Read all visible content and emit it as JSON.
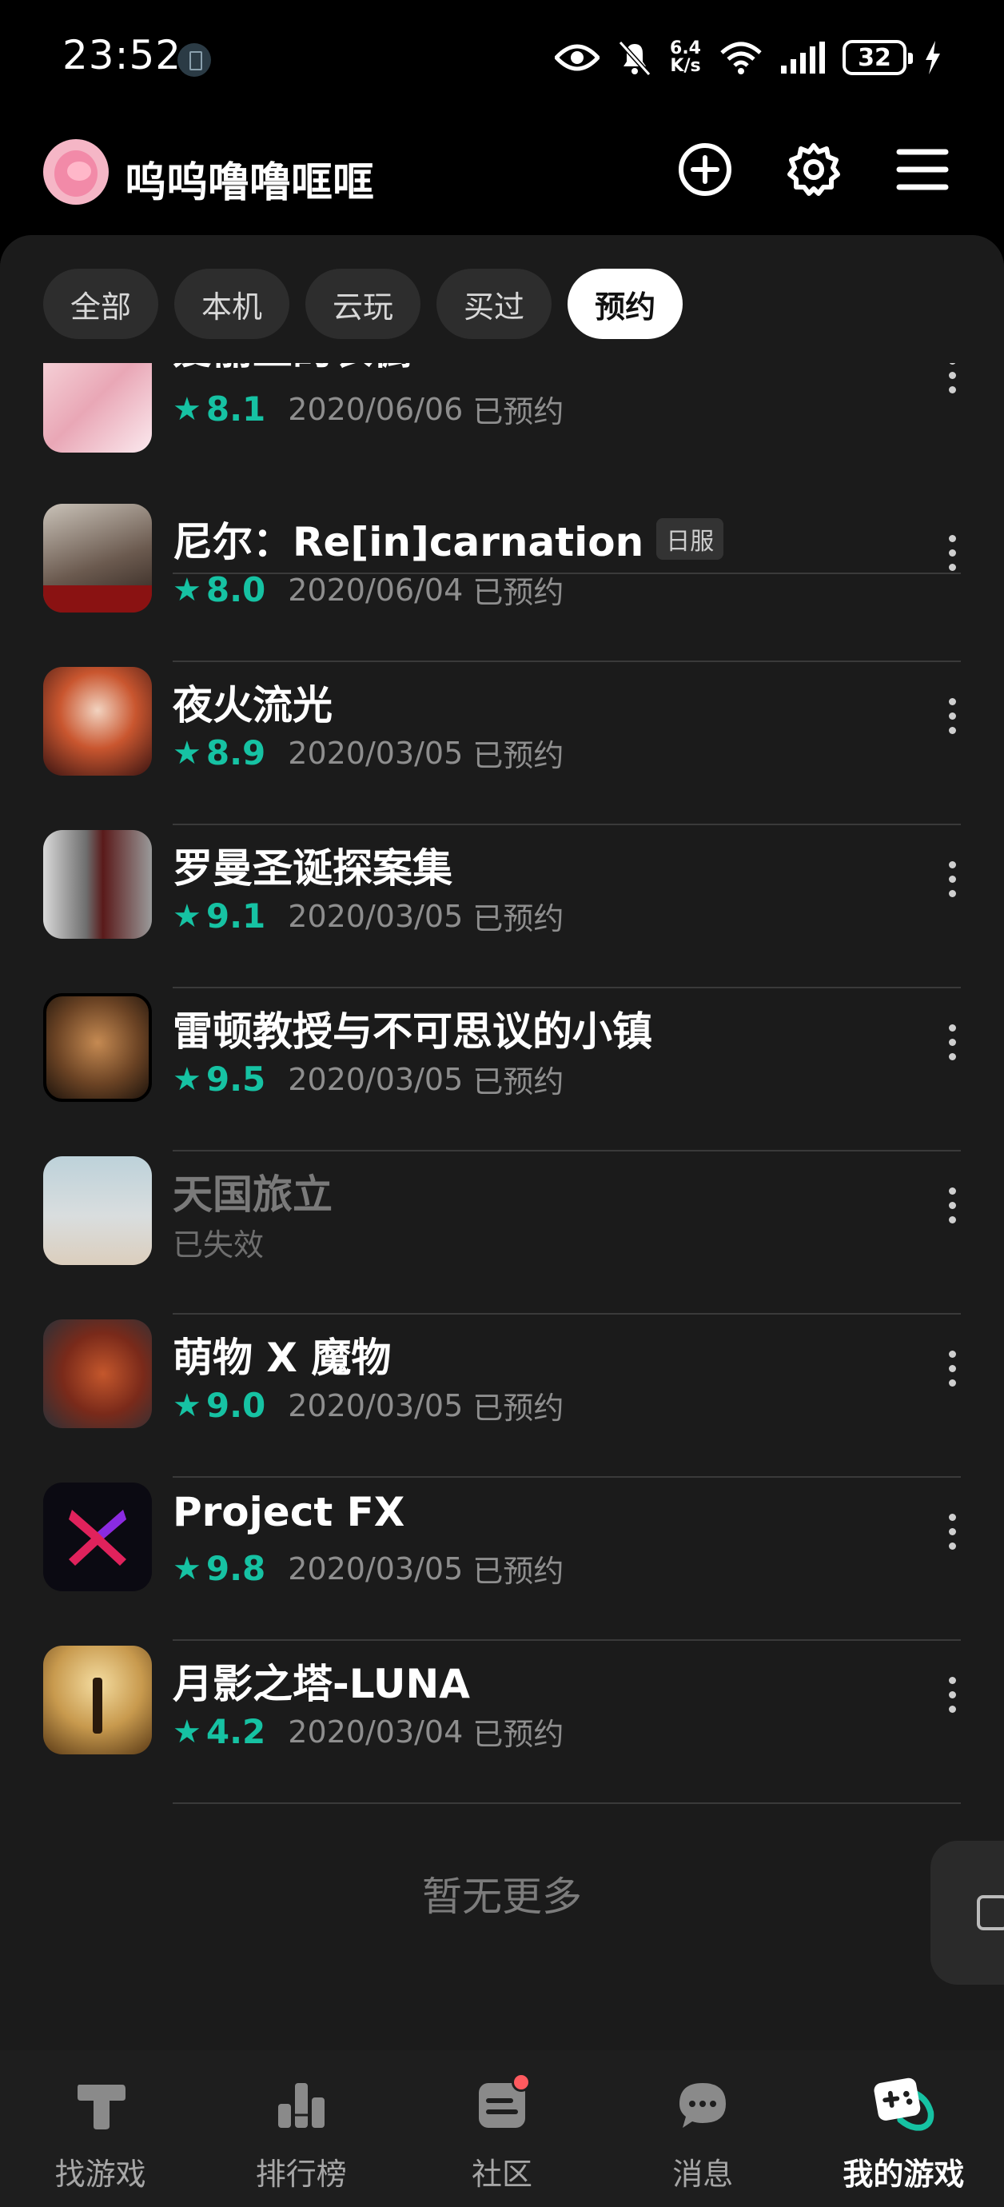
{
  "status_bar": {
    "time": "23:52",
    "net_speed_value": "6.4",
    "net_speed_unit": "K/s",
    "wifi_label": "6",
    "battery": "32"
  },
  "header": {
    "username": "呜呜噜噜哐哐"
  },
  "tabs": [
    {
      "label": "全部",
      "active": false
    },
    {
      "label": "本机",
      "active": false
    },
    {
      "label": "云玩",
      "active": false
    },
    {
      "label": "买过",
      "active": false
    },
    {
      "label": "预约",
      "active": true
    }
  ],
  "games": [
    {
      "name": "爱丽丝的衣橱",
      "tag": "",
      "rating": "8.1",
      "date": "2020/06/06",
      "status": "已预约",
      "invalid": false
    },
    {
      "name": "尼尔：Re[in]carnation",
      "tag": "日服",
      "rating": "8.0",
      "date": "2020/06/04",
      "status": "已预约",
      "invalid": false
    },
    {
      "name": "夜火流光",
      "tag": "",
      "rating": "8.9",
      "date": "2020/03/05",
      "status": "已预约",
      "invalid": false
    },
    {
      "name": "罗曼圣诞探案集",
      "tag": "",
      "rating": "9.1",
      "date": "2020/03/05",
      "status": "已预约",
      "invalid": false
    },
    {
      "name": "雷顿教授与不可思议的小镇",
      "tag": "",
      "rating": "9.5",
      "date": "2020/03/05",
      "status": "已预约",
      "invalid": false
    },
    {
      "name": "天国旅立",
      "tag": "",
      "rating": "",
      "date": "",
      "status": "已失效",
      "invalid": true
    },
    {
      "name": "萌物 X 魔物",
      "tag": "",
      "rating": "9.0",
      "date": "2020/03/05",
      "status": "已预约",
      "invalid": false
    },
    {
      "name": "Project FX",
      "tag": "",
      "rating": "9.8",
      "date": "2020/03/05",
      "status": "已预约",
      "invalid": false
    },
    {
      "name": "月影之塔-LUNA",
      "tag": "",
      "rating": "4.2",
      "date": "2020/03/04",
      "status": "已预约",
      "invalid": false
    }
  ],
  "list_footer": "暂无更多",
  "bottom_nav": [
    {
      "label": "找游戏",
      "icon": "find-game-icon",
      "active": false
    },
    {
      "label": "排行榜",
      "icon": "ranking-icon",
      "active": false
    },
    {
      "label": "社区",
      "icon": "community-icon",
      "active": false,
      "badge": true
    },
    {
      "label": "消息",
      "icon": "message-icon",
      "active": false
    },
    {
      "label": "我的游戏",
      "icon": "my-games-icon",
      "active": true
    }
  ],
  "colors": {
    "accent": "#16c2a3",
    "panel": "#1b1b1b",
    "badge": "#ff5a5f"
  }
}
